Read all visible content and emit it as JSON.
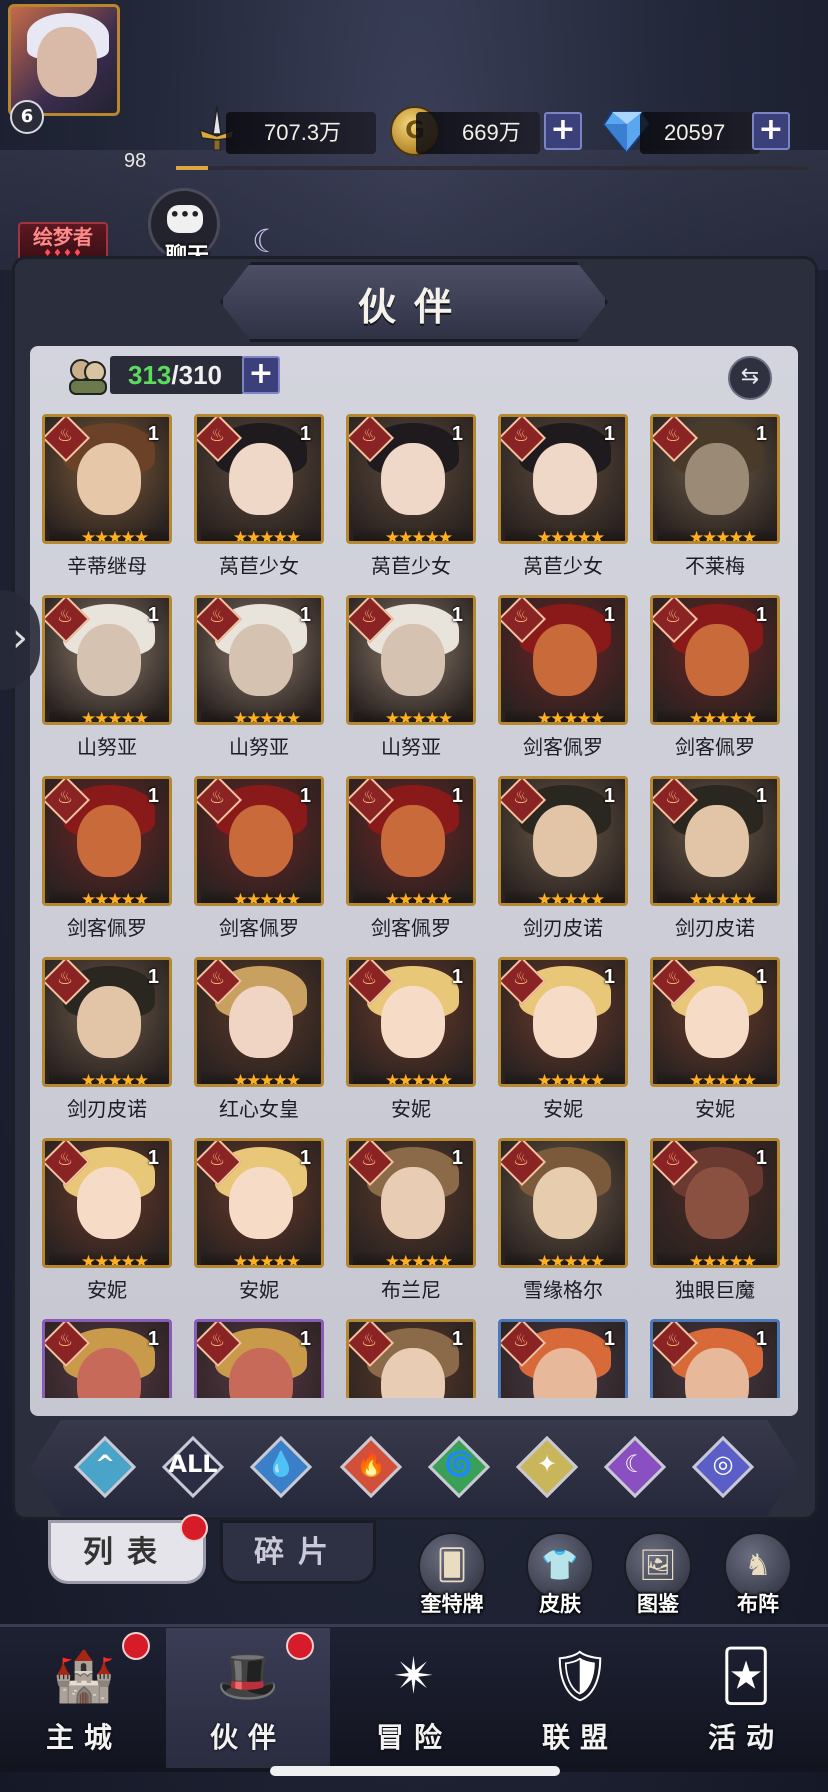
{
  "player": {
    "level": "6",
    "exp": "98",
    "title": "绘梦者",
    "title_stars": "♦♦♦♦"
  },
  "resources": {
    "power": "707.3万",
    "gold": "669万",
    "gems": "20597",
    "gold_glyph": "G",
    "exp_fill": 0.05
  },
  "chat": {
    "label": "聊天",
    "glyph": "•••"
  },
  "panel": {
    "title": "伙伴"
  },
  "roster": {
    "current": "313",
    "max": "/310"
  },
  "cards": [
    {
      "name": "辛蒂继母",
      "stars": "★★★★★",
      "lvl": "1",
      "look": "woman-brown"
    },
    {
      "name": "莴苣少女",
      "stars": "★★★★★",
      "lvl": "1",
      "look": "girl-dark"
    },
    {
      "name": "莴苣少女",
      "stars": "★★★★★",
      "lvl": "1",
      "look": "girl-dark"
    },
    {
      "name": "莴苣少女",
      "stars": "★★★★★",
      "lvl": "1",
      "look": "girl-dark"
    },
    {
      "name": "不莱梅",
      "stars": "★★★★★",
      "lvl": "1",
      "look": "donkey"
    },
    {
      "name": "山努亚",
      "stars": "★★★★★",
      "lvl": "1",
      "look": "old-king"
    },
    {
      "name": "山努亚",
      "stars": "★★★★★",
      "lvl": "1",
      "look": "old-king"
    },
    {
      "name": "山努亚",
      "stars": "★★★★★",
      "lvl": "1",
      "look": "old-king"
    },
    {
      "name": "剑客佩罗",
      "stars": "★★★★★",
      "lvl": "1",
      "look": "fox"
    },
    {
      "name": "剑客佩罗",
      "stars": "★★★★★",
      "lvl": "1",
      "look": "fox"
    },
    {
      "name": "剑客佩罗",
      "stars": "★★★★★",
      "lvl": "1",
      "look": "fox"
    },
    {
      "name": "剑客佩罗",
      "stars": "★★★★★",
      "lvl": "1",
      "look": "fox"
    },
    {
      "name": "剑客佩罗",
      "stars": "★★★★★",
      "lvl": "1",
      "look": "fox"
    },
    {
      "name": "剑刃皮诺",
      "stars": "★★★★★",
      "lvl": "1",
      "look": "boy"
    },
    {
      "name": "剑刃皮诺",
      "stars": "★★★★★",
      "lvl": "1",
      "look": "boy"
    },
    {
      "name": "剑刃皮诺",
      "stars": "★★★★★",
      "lvl": "1",
      "look": "boy"
    },
    {
      "name": "红心女皇",
      "stars": "★★★★★",
      "lvl": "",
      "look": "queen"
    },
    {
      "name": "安妮",
      "stars": "★★★★★",
      "lvl": "1",
      "look": "annie"
    },
    {
      "name": "安妮",
      "stars": "★★★★★",
      "lvl": "1",
      "look": "annie"
    },
    {
      "name": "安妮",
      "stars": "★★★★★",
      "lvl": "1",
      "look": "annie"
    },
    {
      "name": "安妮",
      "stars": "★★★★★",
      "lvl": "1",
      "look": "annie"
    },
    {
      "name": "安妮",
      "stars": "★★★★★",
      "lvl": "1",
      "look": "annie"
    },
    {
      "name": "布兰尼",
      "stars": "★★★★★",
      "lvl": "1",
      "look": "hood"
    },
    {
      "name": "雪缘格尔",
      "stars": "★★★★★",
      "lvl": "",
      "look": "boy2"
    },
    {
      "name": "独眼巨魔",
      "stars": "★★★★★",
      "lvl": "1",
      "look": "ogre"
    },
    {
      "name": "",
      "stars": "",
      "lvl": "1",
      "look": "frog",
      "frame": "purple"
    },
    {
      "name": "",
      "stars": "",
      "lvl": "1",
      "look": "frog",
      "frame": "purple"
    },
    {
      "name": "",
      "stars": "",
      "lvl": "1",
      "look": "hood"
    },
    {
      "name": "",
      "stars": "",
      "lvl": "1",
      "look": "crab",
      "frame": "blue"
    },
    {
      "name": "",
      "stars": "",
      "lvl": "1",
      "look": "crab",
      "frame": "blue"
    }
  ],
  "filters": [
    {
      "glyph": "^",
      "color": "#4aa3c9",
      "icon": "filter-all-light-icon"
    },
    {
      "glyph": "ALL",
      "color": "#2b2d44",
      "icon": "filter-all-icon"
    },
    {
      "glyph": "💧",
      "color": "#3a7fc8",
      "icon": "water-icon"
    },
    {
      "glyph": "🔥",
      "color": "#d2503a",
      "icon": "fire-icon"
    },
    {
      "glyph": "🌀",
      "color": "#3aa058",
      "icon": "wind-icon"
    },
    {
      "glyph": "✦",
      "color": "#c9b55a",
      "icon": "light-icon"
    },
    {
      "glyph": "☾",
      "color": "#8a4fc0",
      "icon": "dark-icon"
    },
    {
      "glyph": "◎",
      "color": "#5c5ec8",
      "icon": "planet-icon"
    }
  ],
  "tabs": {
    "list": "列表",
    "fragments": "碎片"
  },
  "tools": [
    {
      "label": "奎特牌",
      "glyph": "🂠"
    },
    {
      "label": "皮肤",
      "glyph": "👕"
    },
    {
      "label": "图鉴",
      "glyph": "🖼"
    },
    {
      "label": "布阵",
      "glyph": "♞"
    }
  ],
  "nav": [
    {
      "label": "主城",
      "glyph": "🏰",
      "active": false,
      "dot": true
    },
    {
      "label": "伙伴",
      "glyph": "🎩",
      "active": true,
      "dot": true
    },
    {
      "label": "冒险",
      "glyph": "✴",
      "active": false,
      "dot": false
    },
    {
      "label": "联盟",
      "glyph": "🛡",
      "active": false,
      "dot": false
    },
    {
      "label": "活动",
      "glyph": "🃏",
      "active": false,
      "dot": false
    }
  ],
  "side_arrow": "›"
}
